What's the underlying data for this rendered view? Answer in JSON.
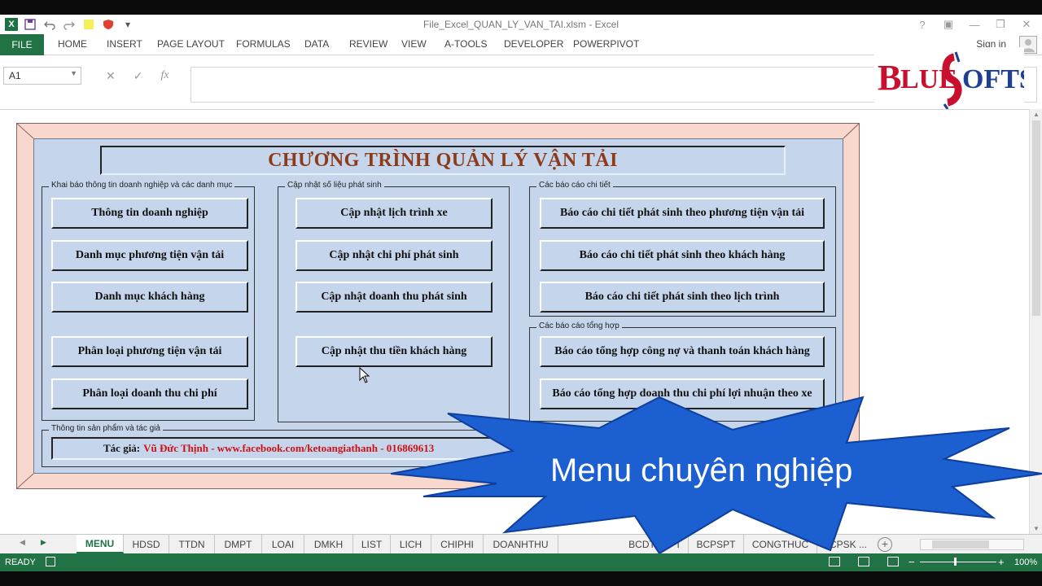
{
  "window": {
    "title": "File_Excel_QUAN_LY_VAN_TAI.xlsm - Excel",
    "help": "?",
    "ribbon_display": "▣",
    "minimize": "—",
    "restore": "❐",
    "close": "✕"
  },
  "qat": {
    "app_icon": "X",
    "save_icon": "save-icon",
    "undo_icon": "undo-icon",
    "redo_icon": "redo-icon"
  },
  "ribbon": {
    "tabs": [
      "FILE",
      "HOME",
      "INSERT",
      "PAGE LAYOUT",
      "FORMULAS",
      "DATA",
      "REVIEW",
      "VIEW",
      "A-TOOLS",
      "DEVELOPER",
      "POWERPIVOT"
    ],
    "signin": "Sign in"
  },
  "formula_bar": {
    "name_box": "A1",
    "cancel": "✕",
    "enter": "✓",
    "fx": "fx",
    "value": ""
  },
  "logo": {
    "text": "BLUESOFTS",
    "colors": {
      "red": "#c8102e",
      "blue": "#1f3f8f"
    }
  },
  "form": {
    "title": "CHƯƠNG TRÌNH QUẢN LÝ VẬN TẢI",
    "groups": {
      "company": {
        "label": "Khai báo thông tin doanh nghiệp và các danh mục",
        "buttons": [
          "Thông tin doanh nghiệp",
          "Danh mục phương tiện vận tải",
          "Danh mục khách hàng",
          "Phân loại phương tiện vận tải",
          "Phân loại doanh thu chi phí"
        ]
      },
      "update": {
        "label": "Cập nhật số liệu phát sinh",
        "buttons": [
          "Cập nhật lịch trình xe",
          "Cập nhật chi phí phát sinh",
          "Cập nhật doanh thu phát sinh",
          "Cập nhật thu tiền khách hàng"
        ]
      },
      "detail_reports": {
        "label": "Các báo cáo chi tiết",
        "buttons": [
          "Báo cáo chi tiết phát sinh theo phương tiện vận tải",
          "Báo cáo chi tiết phát sinh theo khách hàng",
          "Báo cáo chi tiết phát sinh theo lịch trình"
        ]
      },
      "summary_reports": {
        "label": "Các báo cáo tổng hợp",
        "buttons": [
          "Báo cáo tổng hợp công nợ và thanh toán khách hàng",
          "Báo cáo tổng hợp doanh thu chi phí lợi nhuận theo xe"
        ]
      },
      "product_info": {
        "label": "Thông tin sản phẩm và tác giả",
        "author_prefix": "Tác giả:",
        "author_text": "Vũ Đức Thịnh - www.facebook.com/ketoangiathanh - 016869613"
      }
    },
    "colors": {
      "frame": "#f8d8cc",
      "panel": "#c5d6ec",
      "title": "#8b3a1a",
      "author": "#d01010"
    }
  },
  "overlay": {
    "text": "Menu chuyên nghiệp",
    "color": "#1b5fd1"
  },
  "sheet_tabs": {
    "tabs": [
      "MENU",
      "HDSD",
      "TTDN",
      "DMPT",
      "LOAI",
      "DMKH",
      "LIST",
      "LICH",
      "CHIPHI",
      "DOANHTHU",
      "BCDTCPPT",
      "BCPSPT",
      "CONGTHUC",
      "BCPSK ..."
    ],
    "active": "MENU"
  },
  "status": {
    "ready": "READY",
    "zoom": "100%"
  }
}
